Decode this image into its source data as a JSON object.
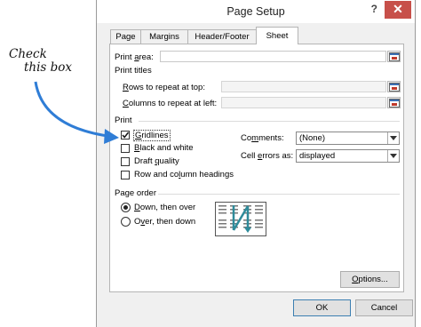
{
  "annotation": {
    "line1": "Check",
    "line2": "this box"
  },
  "dialog": {
    "title": "Page Setup",
    "help": "?",
    "close": "✕",
    "tabs": [
      "Page",
      "Margins",
      "Header/Footer",
      "Sheet"
    ],
    "active_tab": "Sheet",
    "print_area": {
      "label_pre": "Print ",
      "label_u": "a",
      "label_post": "rea:",
      "value": ""
    },
    "print_titles": {
      "heading": "Print titles",
      "rows": {
        "label_u": "R",
        "label_post": "ows to repeat at top:",
        "value": ""
      },
      "columns": {
        "label_u": "C",
        "label_post": "olumns to repeat at left:",
        "value": ""
      }
    },
    "print": {
      "heading": "Print",
      "gridlines": {
        "label_u": "G",
        "label_post": "ridlines",
        "checked": true
      },
      "black_white": {
        "label_u": "B",
        "label_post": "lack and white",
        "checked": false
      },
      "draft": {
        "label_pre": "Draft ",
        "label_u": "q",
        "label_post": "uality",
        "checked": false
      },
      "headings": {
        "label_pre": "Row and co",
        "label_u": "l",
        "label_post": "umn headings",
        "checked": false
      },
      "comments": {
        "label_pre": "Co",
        "label_u": "m",
        "label_post": "ments:",
        "value": "(None)"
      },
      "cell_errors": {
        "label_pre": "Cell ",
        "label_u": "e",
        "label_post": "rrors as:",
        "value": "displayed"
      }
    },
    "page_order": {
      "heading": "Page order",
      "down": {
        "label_u": "D",
        "label_post": "own, then over",
        "selected": true
      },
      "over": {
        "label_pre": "O",
        "label_u": "v",
        "label_post": "er, then down",
        "selected": false
      }
    },
    "buttons": {
      "options": {
        "label_u": "O",
        "label_post": "ptions..."
      },
      "ok": "OK",
      "cancel": "Cancel"
    }
  }
}
